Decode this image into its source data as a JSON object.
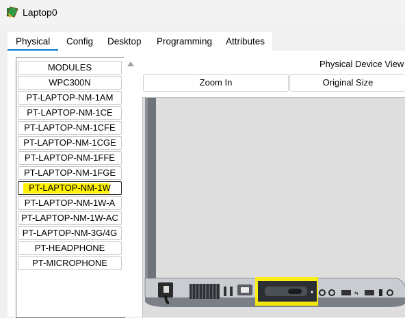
{
  "window": {
    "title": "Laptop0",
    "icon": "device-icon"
  },
  "tabs": [
    {
      "label": "Physical"
    },
    {
      "label": "Config"
    },
    {
      "label": "Desktop"
    },
    {
      "label": "Programming"
    },
    {
      "label": "Attributes"
    }
  ],
  "modules": {
    "items": [
      "MODULES",
      "WPC300N",
      "PT-LAPTOP-NM-1AM",
      "PT-LAPTOP-NM-1CE",
      "PT-LAPTOP-NM-1CFE",
      "PT-LAPTOP-NM-1CGE",
      "PT-LAPTOP-NM-1FFE",
      "PT-LAPTOP-NM-1FGE",
      "PT-LAPTOP-NM-1W",
      "PT-LAPTOP-NM-1W-A",
      "PT-LAPTOP-NM-1W-AC",
      "PT-LAPTOP-NM-3G/4G",
      "PT-HEADPHONE",
      "PT-MICROPHONE"
    ],
    "selected": "PT-LAPTOP-NM-1W"
  },
  "physical_view": {
    "label": "Physical Device View",
    "zoom_in": "Zoom In",
    "original_size": "Original Size"
  },
  "colors": {
    "highlight": "#fff200",
    "accent": "#0078d4"
  }
}
